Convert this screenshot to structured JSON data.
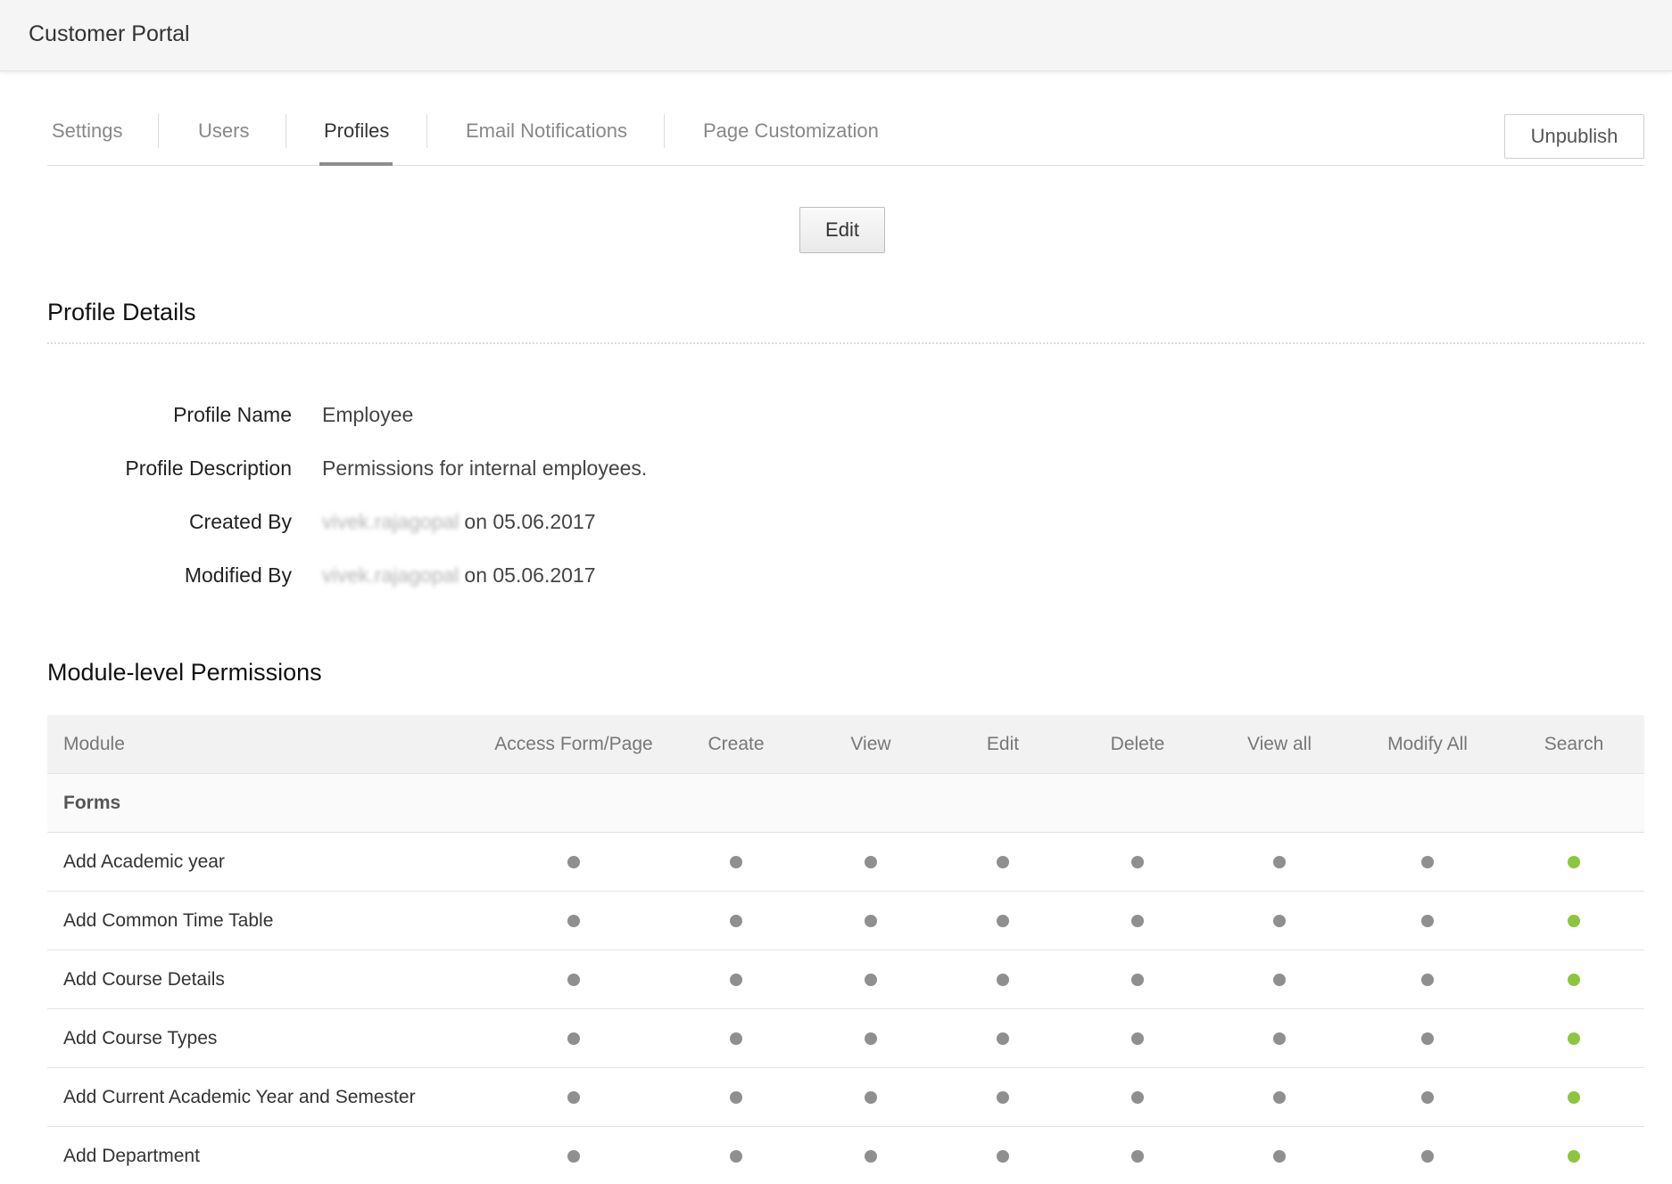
{
  "app": {
    "title": "Customer Portal"
  },
  "tabs": [
    {
      "label": "Settings",
      "active": false
    },
    {
      "label": "Users",
      "active": false
    },
    {
      "label": "Profiles",
      "active": true
    },
    {
      "label": "Email Notifications",
      "active": false
    },
    {
      "label": "Page Customization",
      "active": false
    }
  ],
  "actions": {
    "unpublish_label": "Unpublish",
    "edit_label": "Edit"
  },
  "profile_details": {
    "title": "Profile Details",
    "fields": [
      {
        "label": "Profile Name",
        "value": "Employee"
      },
      {
        "label": "Profile Description",
        "value": "Permissions for internal employees."
      },
      {
        "label": "Created By",
        "user": "vivek.rajagopal",
        "value": "on 05.06.2017"
      },
      {
        "label": "Modified By",
        "user": "vivek.rajagopal",
        "value": "on 05.06.2017"
      }
    ]
  },
  "permissions": {
    "title": "Module-level Permissions",
    "columns": [
      "Module",
      "Access Form/Page",
      "Create",
      "View",
      "Edit",
      "Delete",
      "View all",
      "Modify All",
      "Search"
    ],
    "group_label": "Forms",
    "rows": [
      {
        "module": "Add Academic year",
        "perms": [
          false,
          false,
          false,
          false,
          false,
          false,
          false,
          true
        ]
      },
      {
        "module": "Add Common Time Table",
        "perms": [
          false,
          false,
          false,
          false,
          false,
          false,
          false,
          true
        ]
      },
      {
        "module": "Add Course Details",
        "perms": [
          false,
          false,
          false,
          false,
          false,
          false,
          false,
          true
        ]
      },
      {
        "module": "Add Course Types",
        "perms": [
          false,
          false,
          false,
          false,
          false,
          false,
          false,
          true
        ]
      },
      {
        "module": "Add Current Academic Year and Semester",
        "perms": [
          false,
          false,
          false,
          false,
          false,
          false,
          false,
          true
        ]
      },
      {
        "module": "Add Department",
        "perms": [
          false,
          false,
          false,
          false,
          false,
          false,
          false,
          true
        ]
      }
    ]
  },
  "colors": {
    "enabled_dot": "#8cc63f",
    "disabled_dot": "#8f8f8f"
  }
}
